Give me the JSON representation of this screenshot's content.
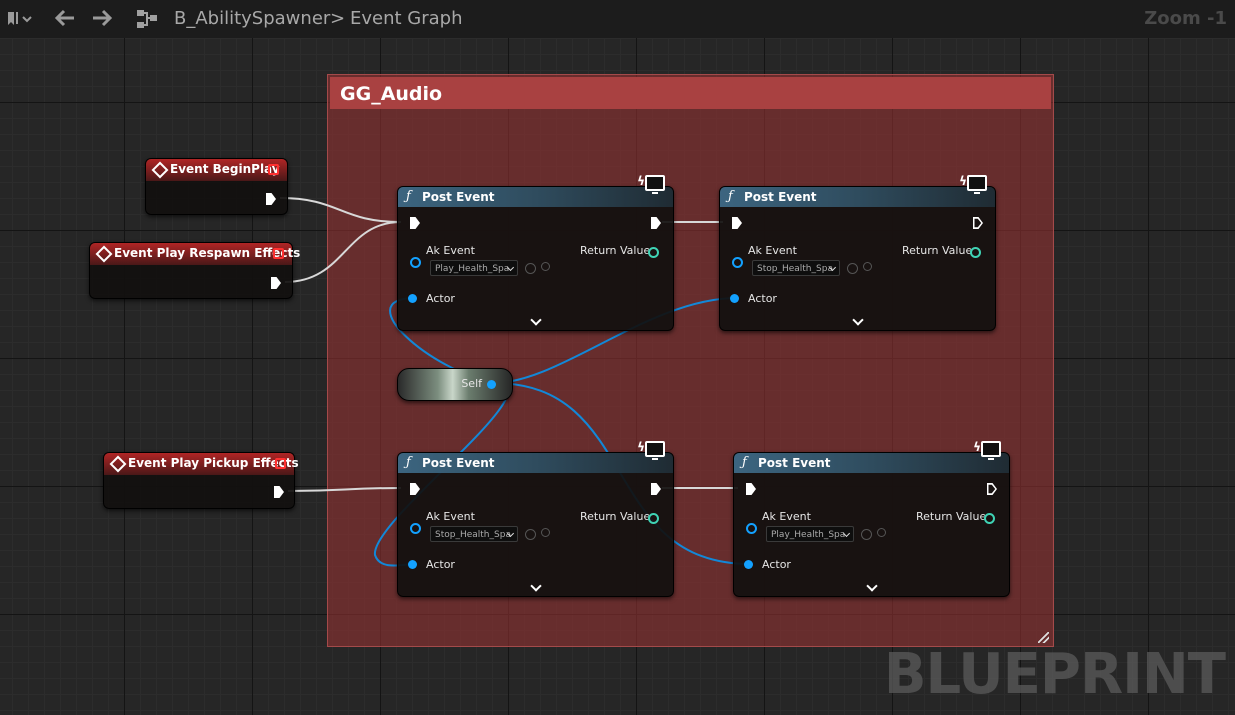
{
  "toolbar": {
    "breadcrumb_asset": "B_AbilitySpawner",
    "breadcrumb_separator": ">",
    "breadcrumb_graph": "Event Graph",
    "zoom": "Zoom -1"
  },
  "comment": {
    "title": "GG_Audio"
  },
  "events": [
    {
      "title": "Event BeginPlay"
    },
    {
      "title": "Event Play Respawn Effects"
    },
    {
      "title": "Event Play Pickup Effects"
    }
  ],
  "post_events": [
    {
      "title": "Post Event",
      "ak_event_label": "Ak Event",
      "ak_event_value": "Play_Health_Spa",
      "return_label": "Return Value",
      "actor_label": "Actor"
    },
    {
      "title": "Post Event",
      "ak_event_label": "Ak Event",
      "ak_event_value": "Stop_Health_Spa",
      "return_label": "Return Value",
      "actor_label": "Actor"
    },
    {
      "title": "Post Event",
      "ak_event_label": "Ak Event",
      "ak_event_value": "Stop_Health_Spa",
      "return_label": "Return Value",
      "actor_label": "Actor"
    },
    {
      "title": "Post Event",
      "ak_event_label": "Ak Event",
      "ak_event_value": "Play_Health_Spa",
      "return_label": "Return Value",
      "actor_label": "Actor"
    }
  ],
  "self_node": {
    "label": "Self"
  },
  "watermark": "BLUEPRINT",
  "colors": {
    "comment": "#a94141",
    "event_header": "#b02525",
    "function_header": "#3c6580",
    "object_pin": "#13a1ff",
    "return_pin": "#3fd3b5"
  }
}
